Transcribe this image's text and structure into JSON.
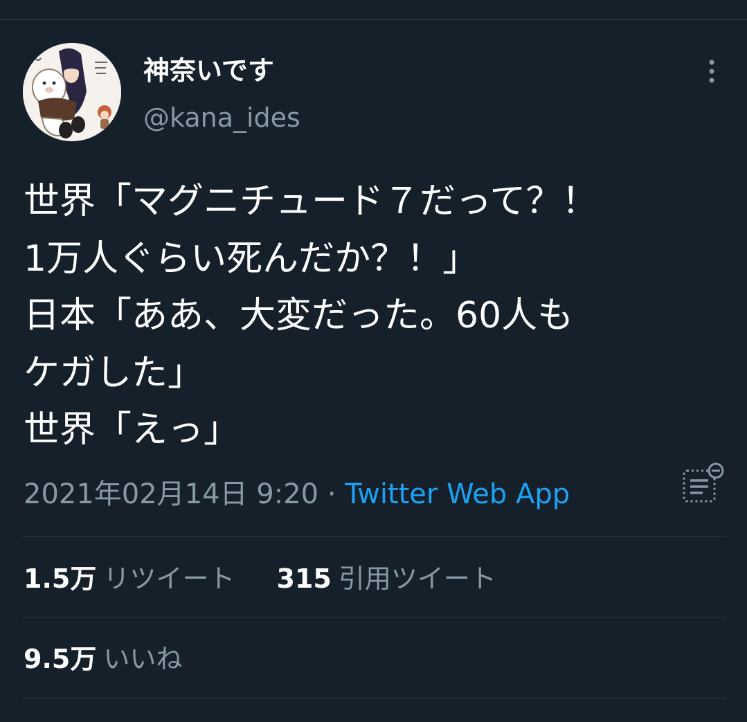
{
  "author": {
    "display_name": "神奈いです",
    "handle": "@kana_ides",
    "avatar_icon": "illustrated-profile-avatar"
  },
  "tweet": {
    "lines": [
      "世界「マグニチュード７だって？！",
      "1万人ぐらい死んだか？！」",
      "日本「ああ、大変だった。60人も",
      "ケガした」",
      "世界「えっ」"
    ],
    "timestamp": "2021年02月14日 9:20",
    "separator": "·",
    "source": "Twitter Web App"
  },
  "stats": {
    "retweets_count": "1.5万",
    "retweets_label": "リツイート",
    "quotes_count": "315",
    "quotes_label": "引用ツイート",
    "likes_count": "9.5万",
    "likes_label": "いいね"
  },
  "icons": {
    "menu": "more-vertical-icon",
    "analytics": "tweet-analytics-icon"
  },
  "colors": {
    "background": "#15202b",
    "primary_text": "#ffffff",
    "secondary_text": "#8899a6",
    "link": "#1da1f2",
    "divider": "#2f3b48"
  }
}
